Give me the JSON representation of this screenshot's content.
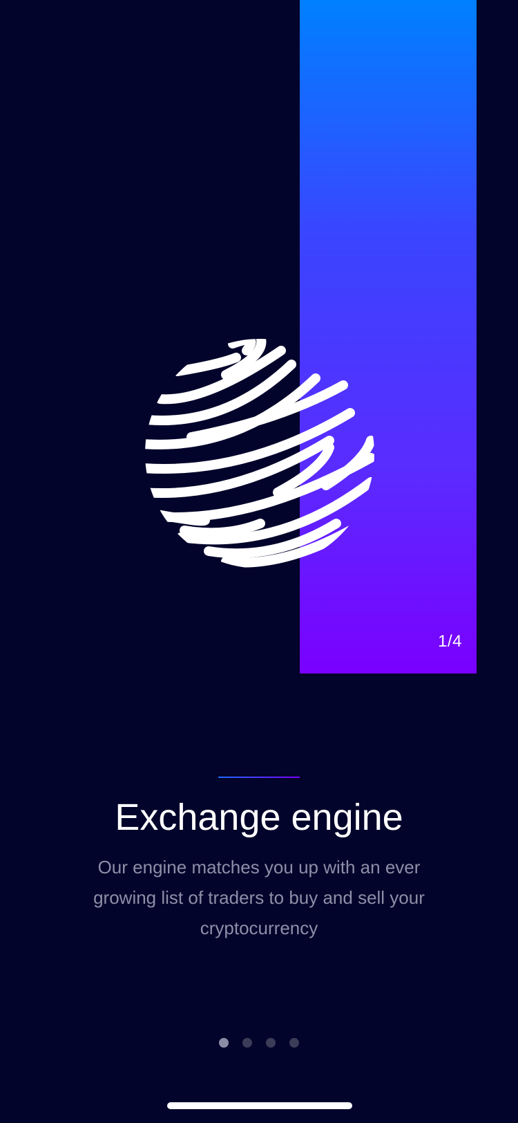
{
  "onboarding": {
    "page_counter": "1/4",
    "title": "Exchange engine",
    "description": "Our engine matches you up with an ever growing list of traders to buy and sell your cryptocurrency",
    "pagination": {
      "total": 4,
      "active_index": 0
    }
  },
  "illustration": {
    "icon": "striped-globe-icon"
  },
  "colors": {
    "background": "#03042b",
    "panel_gradient_top": "#0080ff",
    "panel_gradient_bottom": "#7a00ff",
    "description_text": "#8d8fa8",
    "dot_active": "#8a8da6",
    "dot_inactive": "#3a3c58"
  }
}
